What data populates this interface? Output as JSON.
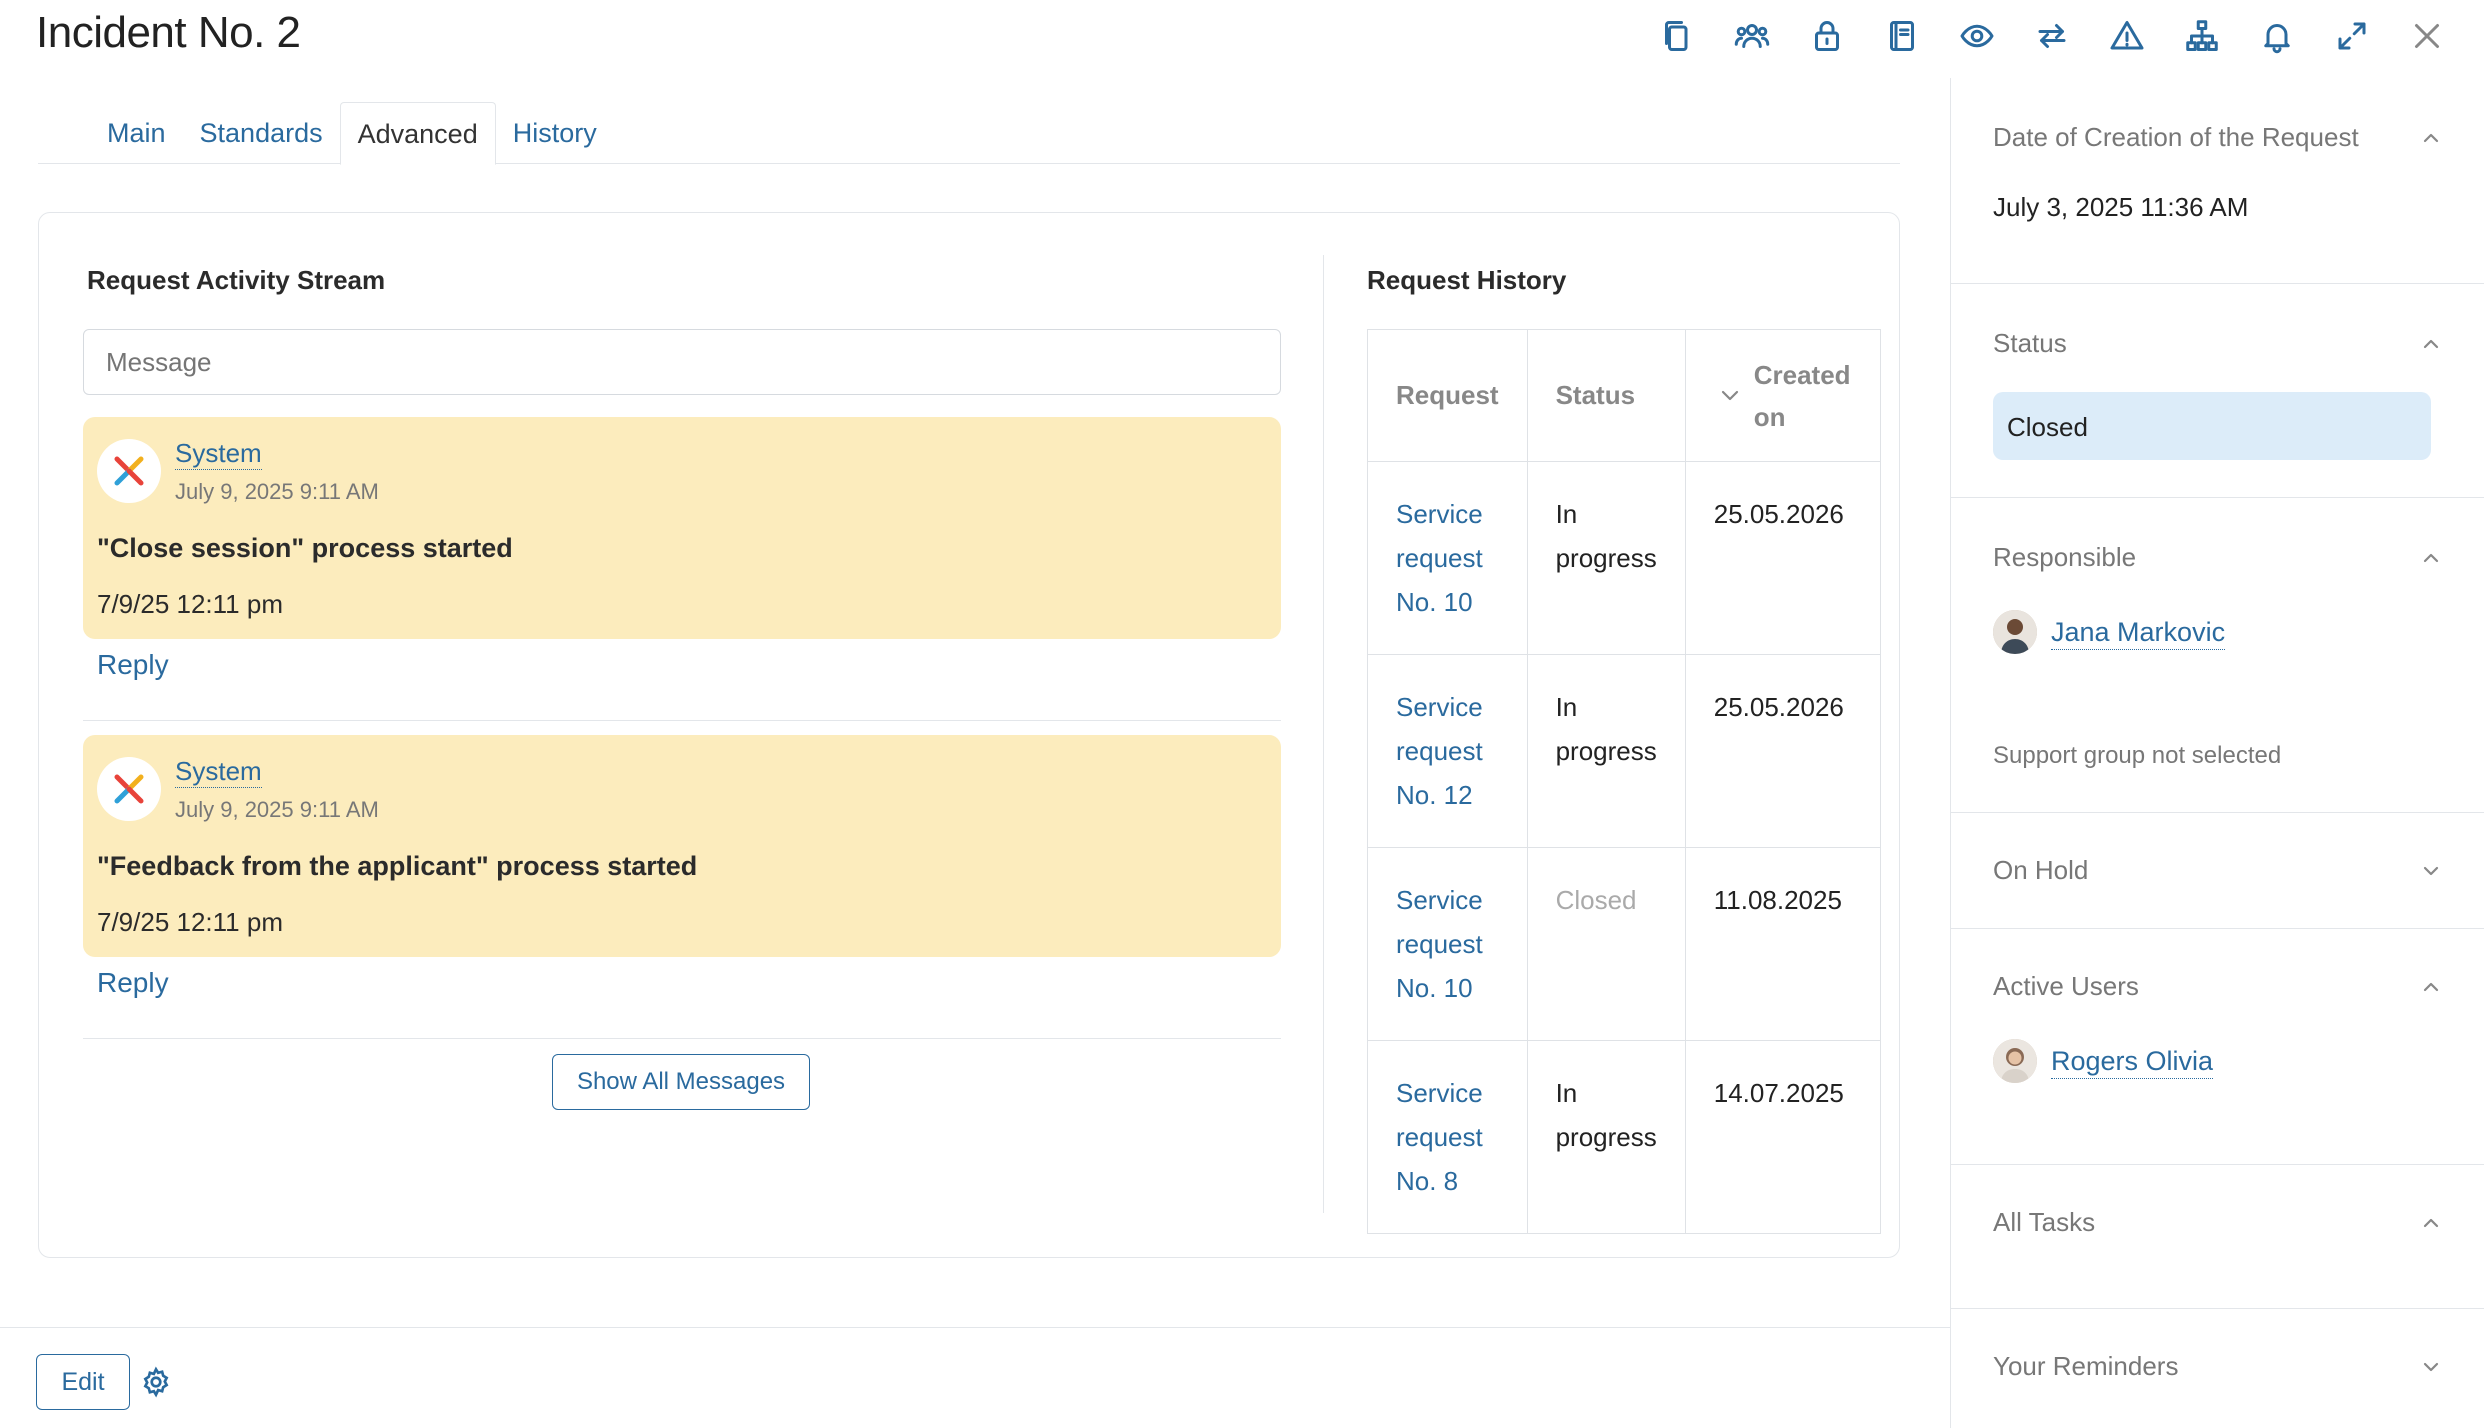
{
  "header": {
    "title": "Incident No. 2",
    "toolbar_icons": [
      "copy-icon",
      "users-icon",
      "lock-icon",
      "book-icon",
      "eye-icon",
      "swap-icon",
      "warning-icon",
      "hierarchy-icon",
      "bell-icon",
      "expand-icon",
      "close-icon"
    ]
  },
  "tabs": [
    {
      "label": "Main"
    },
    {
      "label": "Standards"
    },
    {
      "label": "Advanced",
      "active": true
    },
    {
      "label": "History"
    }
  ],
  "activity": {
    "title": "Request Activity Stream",
    "placeholder": "Message",
    "messages": [
      {
        "author": "System",
        "date": "July 9, 2025 9:11 AM",
        "text": "\"Close session\" process started",
        "time": "7/9/25 12:11 pm",
        "reply": "Reply"
      },
      {
        "author": "System",
        "date": "July 9, 2025 9:11 AM",
        "text": "\"Feedback from the applicant\" process started",
        "time": "7/9/25 12:11 pm",
        "reply": "Reply"
      }
    ],
    "show_all": "Show All Messages"
  },
  "history": {
    "title": "Request History",
    "columns": [
      "Request",
      "Status",
      "Created on"
    ],
    "rows": [
      {
        "request": "Service request No. 10",
        "status": "In progress",
        "created": "25.05.2026"
      },
      {
        "request": "Service request No. 12",
        "status": "In progress",
        "created": "25.05.2026"
      },
      {
        "request": "Service request No. 10",
        "status": "Closed",
        "created": "11.08.2025"
      },
      {
        "request": "Service request No. 8",
        "status": "In progress",
        "created": "14.07.2025"
      }
    ]
  },
  "footer": {
    "edit": "Edit"
  },
  "sidebar": {
    "creation": {
      "label": "Date of Creation of the Request",
      "value": "July 3, 2025 11:36 AM"
    },
    "status": {
      "label": "Status",
      "value": "Closed"
    },
    "responsible": {
      "label": "Responsible",
      "user": "Jana Markovic",
      "note": "Support group not selected"
    },
    "on_hold": {
      "label": "On Hold"
    },
    "active_users": {
      "label": "Active Users",
      "user": "Rogers Olivia"
    },
    "all_tasks": {
      "label": "All Tasks"
    },
    "reminders": {
      "label": "Your Reminders"
    }
  },
  "colors": {
    "accent": "#2a6a9e",
    "message_bg": "#fcecbd",
    "status_bg": "#dcecf9"
  }
}
